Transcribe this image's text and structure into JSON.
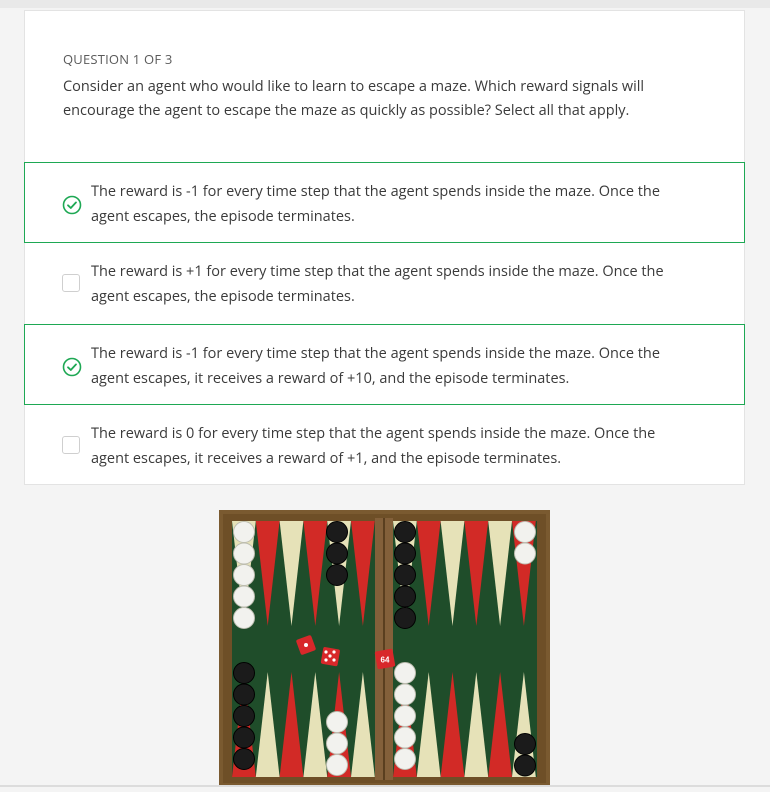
{
  "question": {
    "header": "QUESTION 1 OF 3",
    "text": "Consider an agent who would like to learn to escape a maze. Which reward signals will encourage the agent to escape the maze as quickly as possible? Select all that apply."
  },
  "options": [
    {
      "label": "The reward is -1 for every time step that the agent spends inside the maze. Once the agent escapes, the episode terminates.",
      "selected": true
    },
    {
      "label": "The reward is +1 for every time step that the agent spends inside the maze. Once the agent escapes, the episode terminates.",
      "selected": false
    },
    {
      "label": "The reward is -1 for every time step that the agent spends inside the maze. Once the agent escapes, it receives a reward of +10, and the episode terminates.",
      "selected": true
    },
    {
      "label": "The reward is 0 for every time step that the agent spends inside the maze. Once the agent escapes, it receives a reward of +1, and the episode terminates.",
      "selected": false
    }
  ],
  "colors": {
    "selected_border": "#1ea854",
    "check": "#1ea854"
  },
  "board": {
    "doubling_cube": "64"
  }
}
